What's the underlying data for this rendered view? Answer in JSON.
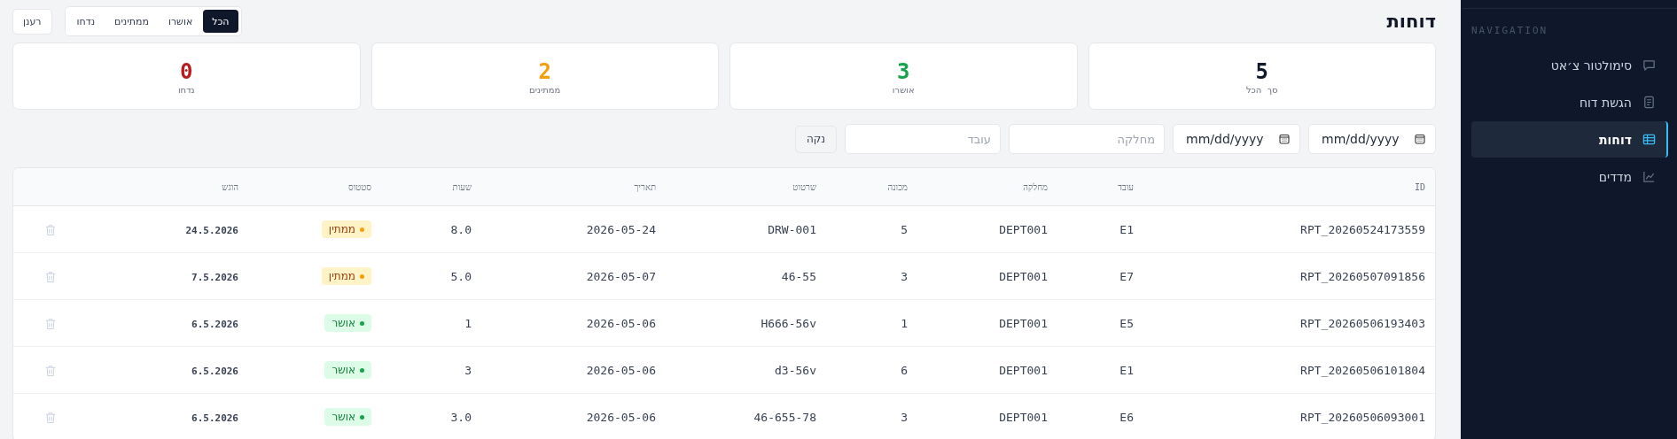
{
  "sidebar": {
    "section_label": "NAVIGATION",
    "items": [
      {
        "label": "סימולטור צ׳אט",
        "selected": false
      },
      {
        "label": "הגשת דוח",
        "selected": false
      },
      {
        "label": "דוחות",
        "selected": true
      },
      {
        "label": "מדדים",
        "selected": false
      }
    ]
  },
  "header": {
    "title": "דוחות",
    "refresh_button": "רענן",
    "tabs": [
      {
        "label": "הכל",
        "selected": true
      },
      {
        "label": "אושרו",
        "selected": false
      },
      {
        "label": "ממתינים",
        "selected": false
      },
      {
        "label": "נדחו",
        "selected": false
      }
    ]
  },
  "stats": [
    {
      "value": "5",
      "label": "סך  הכל",
      "color": "#0f172a"
    },
    {
      "value": "3",
      "label": "אושרו",
      "color": "#16a34a"
    },
    {
      "value": "2",
      "label": "ממתינים",
      "color": "#f59e0b"
    },
    {
      "value": "0",
      "label": "נדחו",
      "color": "#b91c1c"
    }
  ],
  "filters": {
    "date_from": {
      "placeholder": "mm/dd/yyyy"
    },
    "date_to": {
      "placeholder": "mm/dd/yyyy"
    },
    "department": {
      "placeholder": "מחלקה"
    },
    "employee": {
      "placeholder": "עובד"
    },
    "clear_button": "נקה"
  },
  "table": {
    "columns": [
      "ID",
      "עובד",
      "מחלקה",
      "מכונה",
      "שרטוט",
      "תאריך",
      "שעות",
      "סטטוס",
      "הוגש"
    ],
    "rows": [
      {
        "id": "RPT_20260524173559",
        "employee": "E1",
        "department": "DEPT001",
        "machine": "5",
        "drawing": "DRW-001",
        "date": "2026-05-24",
        "hours": "8.0",
        "status": {
          "kind": "pending",
          "label": "ממתין"
        },
        "submitted": "24.5.2026"
      },
      {
        "id": "RPT_20260507091856",
        "employee": "E7",
        "department": "DEPT001",
        "machine": "3",
        "drawing": "46-55",
        "date": "2026-05-07",
        "hours": "5.0",
        "status": {
          "kind": "pending",
          "label": "ממתין"
        },
        "submitted": "7.5.2026"
      },
      {
        "id": "RPT_20260506193403",
        "employee": "E5",
        "department": "DEPT001",
        "machine": "1",
        "drawing": "H666-56v",
        "date": "2026-05-06",
        "hours": "1",
        "status": {
          "kind": "approved",
          "label": "אושר"
        },
        "submitted": "6.5.2026"
      },
      {
        "id": "RPT_20260506101804",
        "employee": "E1",
        "department": "DEPT001",
        "machine": "6",
        "drawing": "d3-56v",
        "date": "2026-05-06",
        "hours": "3",
        "status": {
          "kind": "approved",
          "label": "אושר"
        },
        "submitted": "6.5.2026"
      },
      {
        "id": "RPT_20260506093001",
        "employee": "E6",
        "department": "DEPT001",
        "machine": "3",
        "drawing": "46-655-78",
        "date": "2026-05-06",
        "hours": "3.0",
        "status": {
          "kind": "approved",
          "label": "אושר"
        },
        "submitted": "6.5.2026"
      }
    ]
  }
}
